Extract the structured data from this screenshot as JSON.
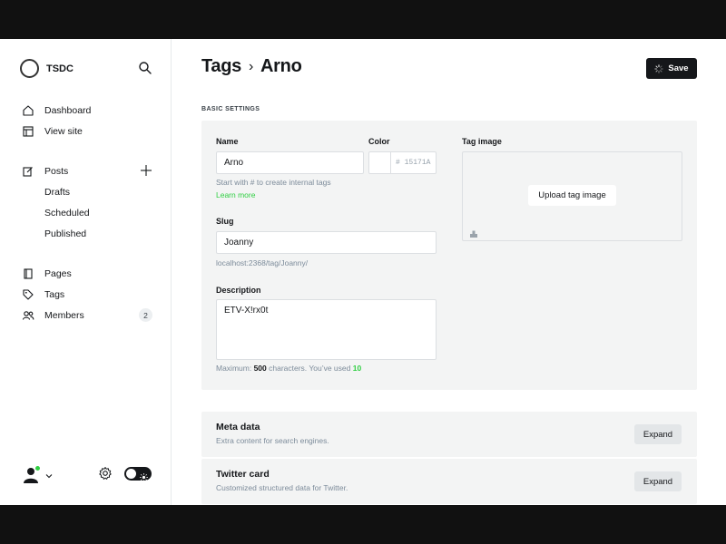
{
  "brand": {
    "name": "TSDC"
  },
  "nav": {
    "dashboard": "Dashboard",
    "view_site": "View site",
    "posts": "Posts",
    "drafts": "Drafts",
    "scheduled": "Scheduled",
    "published": "Published",
    "pages": "Pages",
    "tags": "Tags",
    "members": "Members",
    "members_count": "2"
  },
  "header": {
    "section": "Tags",
    "separator": "›",
    "current": "Arno",
    "save_label": "Save"
  },
  "basic": {
    "section_label": "BASIC SETTINGS",
    "name_label": "Name",
    "name_value": "Arno",
    "color_label": "Color",
    "color_hash": "#",
    "color_value": "15171A",
    "name_hint": "Start with # to create internal tags",
    "learn_more": "Learn more",
    "slug_label": "Slug",
    "slug_value": "Joanny",
    "slug_url": "localhost:2368/tag/Joanny/",
    "description_label": "Description",
    "description_value": "ETV-X!rx0t",
    "counter_prefix": "Maximum: ",
    "counter_max": "500",
    "counter_mid": " characters. You’ve used ",
    "counter_used": "10",
    "tag_image_label": "Tag image",
    "upload_label": "Upload tag image"
  },
  "meta": {
    "title": "Meta data",
    "description": "Extra content for search engines.",
    "expand": "Expand"
  },
  "twitter": {
    "title": "Twitter card",
    "description": "Customized structured data for Twitter.",
    "expand": "Expand"
  },
  "colors": {
    "accent": "#30cf43",
    "dark": "#15171a",
    "panel": "#f3f4f4"
  }
}
